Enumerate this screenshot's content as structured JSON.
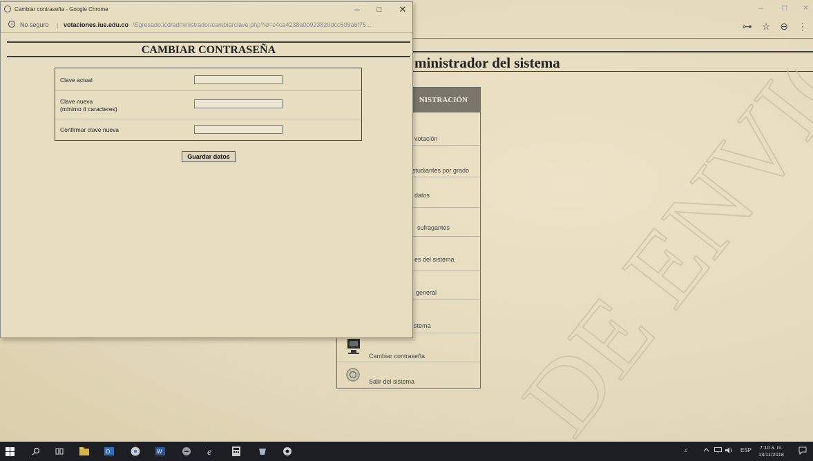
{
  "background_window": {
    "minimize_label": "–",
    "maximize_label": "□",
    "close_label": "×",
    "toolbar_icons": [
      "key-icon",
      "star-icon",
      "account-icon",
      "more-icon"
    ],
    "toolbar_glyphs": [
      "⊶",
      "☆",
      "⊖",
      "⋮"
    ],
    "page_title": "ministrador del sistema",
    "menu": {
      "header": "NISTRACIÓN",
      "items": [
        {
          "label": "votación",
          "icon": "ballot-icon"
        },
        {
          "label": "studiantes por grado",
          "icon": "students-icon"
        },
        {
          "label": "datos",
          "icon": "data-icon"
        },
        {
          "label": "sufragantes",
          "icon": "voters-icon"
        },
        {
          "label": "es del sistema",
          "icon": "settings-icon"
        },
        {
          "label": "general",
          "icon": "report-icon"
        },
        {
          "label": "stema",
          "icon": "system-icon"
        },
        {
          "label": "Cambiar contraseña",
          "icon": "computer-icon"
        },
        {
          "label": "Salir del sistema",
          "icon": "exit-icon"
        }
      ]
    },
    "watermark_text": "DE ENVIGAD"
  },
  "popup": {
    "window_title": "Cambiar contraseña - Google Chrome",
    "minimize_label": "–",
    "maximize_label": "□",
    "close_label": "✕",
    "address": {
      "info_glyph": "i",
      "security_label": "No seguro",
      "separator": "|",
      "domain": "votaciones.iue.edu.co",
      "path": "/Egresado.icd/administrador/cambiarclave.php?id=c4ca4238a0b923820dcc509a6f75..."
    },
    "heading": "CAMBIAR CONTRASEÑA",
    "form": {
      "current_label": "Clave actual",
      "current_value": "",
      "new_label_line1": "Clave nueva",
      "new_label_line2": "(mínimo 4 caracteres)",
      "new_value": "",
      "confirm_label": "Confirmar clave nueva",
      "confirm_value": ""
    },
    "save_label": "Guardar datos"
  },
  "taskbar": {
    "icons": [
      "windows-start-icon",
      "search-icon",
      "task-view-icon",
      "file-explorer-icon",
      "outlook-icon",
      "chrome-icon",
      "word-icon",
      "app-icon",
      "edge-icon",
      "calculator-icon",
      "app2-icon",
      "app3-icon"
    ],
    "tray": {
      "people_glyph": "♫",
      "language": "ESP",
      "time": "7:10 a. m.",
      "date": "13/11/2018"
    }
  },
  "colors": {
    "paper": "#e6dcc0",
    "taskbar": "#1d1d24",
    "menu_header": "#7a766c"
  }
}
